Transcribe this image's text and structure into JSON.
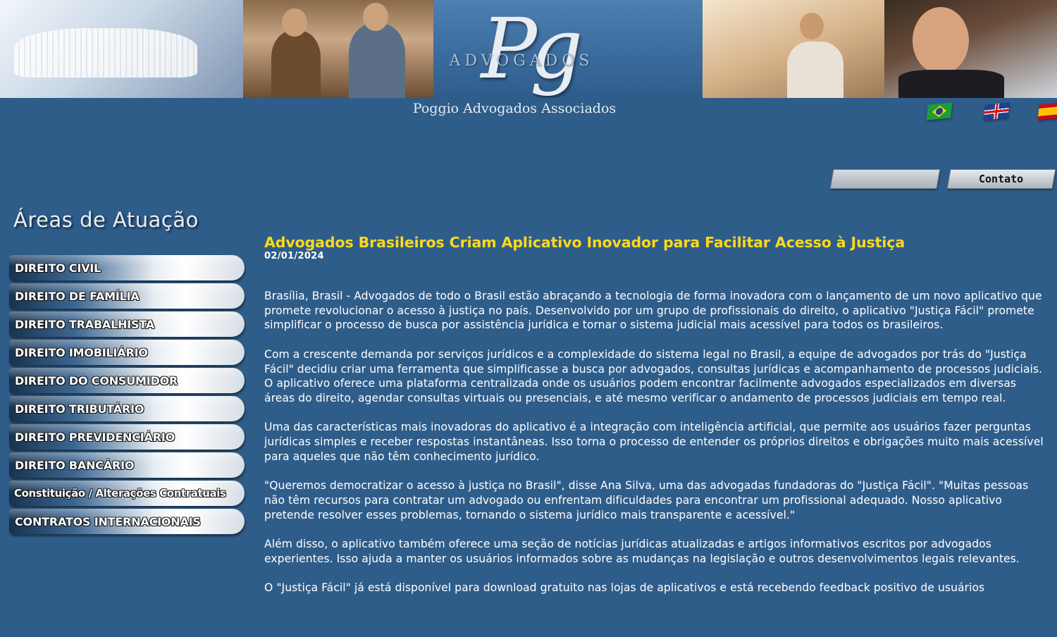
{
  "brand": {
    "logo_letters": "Pg",
    "logo_word": "ADVOGADOS",
    "firm_name": "Poggio Advogados Associados"
  },
  "languages": [
    "brazil-flag",
    "uk-flag",
    "spain-flag"
  ],
  "header": {
    "search_value": "",
    "contact_label": "Contato"
  },
  "sidebar": {
    "title": "Áreas de Atuação",
    "items": [
      {
        "label": "DIREITO CIVIL"
      },
      {
        "label": "DIREITO DE FAMÍLIA"
      },
      {
        "label": "DIREITO TRABALHISTA"
      },
      {
        "label": "DIREITO IMOBILIÁRIO"
      },
      {
        "label": "DIREITO DO CONSUMIDOR"
      },
      {
        "label": "DIREITO TRIBUTÁRIO"
      },
      {
        "label": "DIREITO PREVIDENCIÁRIO"
      },
      {
        "label": "DIREITO BANCÁRIO"
      },
      {
        "label": "Constituição / Alterações Contratuais"
      },
      {
        "label": "CONTRATOS INTERNACIONAIS"
      }
    ]
  },
  "article": {
    "title": "Advogados Brasileiros Criam Aplicativo Inovador para Facilitar Acesso à Justiça",
    "date": "02/01/2024",
    "paragraphs": [
      "Brasília, Brasil - Advogados de todo o Brasil estão abraçando a tecnologia de forma inovadora com o lançamento de um novo aplicativo que promete revolucionar o acesso à justiça no país. Desenvolvido por um grupo de profissionais do direito, o aplicativo \"Justiça Fácil\" promete simplificar o processo de busca por assistência jurídica e tornar o sistema judicial mais acessível para todos os brasileiros.",
      "Com a crescente demanda por serviços jurídicos e a complexidade do sistema legal no Brasil, a equipe de advogados por trás do \"Justiça Fácil\" decidiu criar uma ferramenta que simplificasse a busca por advogados, consultas jurídicas e acompanhamento de processos judiciais. O aplicativo oferece uma plataforma centralizada onde os usuários podem encontrar facilmente advogados especializados em diversas áreas do direito, agendar consultas virtuais ou presenciais, e até mesmo verificar o andamento de processos judiciais em tempo real.",
      "Uma das características mais inovadoras do aplicativo é a integração com inteligência artificial, que permite aos usuários fazer perguntas jurídicas simples e receber respostas instantâneas. Isso torna o processo de entender os próprios direitos e obrigações muito mais acessível para aqueles que não têm conhecimento jurídico.",
      "\"Queremos democratizar o acesso à justiça no Brasil\", disse Ana Silva, uma das advogadas fundadoras do \"Justiça Fácil\". \"Muitas pessoas não têm recursos para contratar um advogado ou enfrentam dificuldades para encontrar um profissional adequado. Nosso aplicativo pretende resolver esses problemas, tornando o sistema jurídico mais transparente e acessível.\"",
      "Além disso, o aplicativo também oferece uma seção de notícias jurídicas atualizadas e artigos informativos escritos por advogados experientes. Isso ajuda a manter os usuários informados sobre as mudanças na legislação e outros desenvolvimentos legais relevantes.",
      "O \"Justiça Fácil\" já está disponível para download gratuito nas lojas de aplicativos e está recebendo feedback positivo de usuários"
    ]
  }
}
